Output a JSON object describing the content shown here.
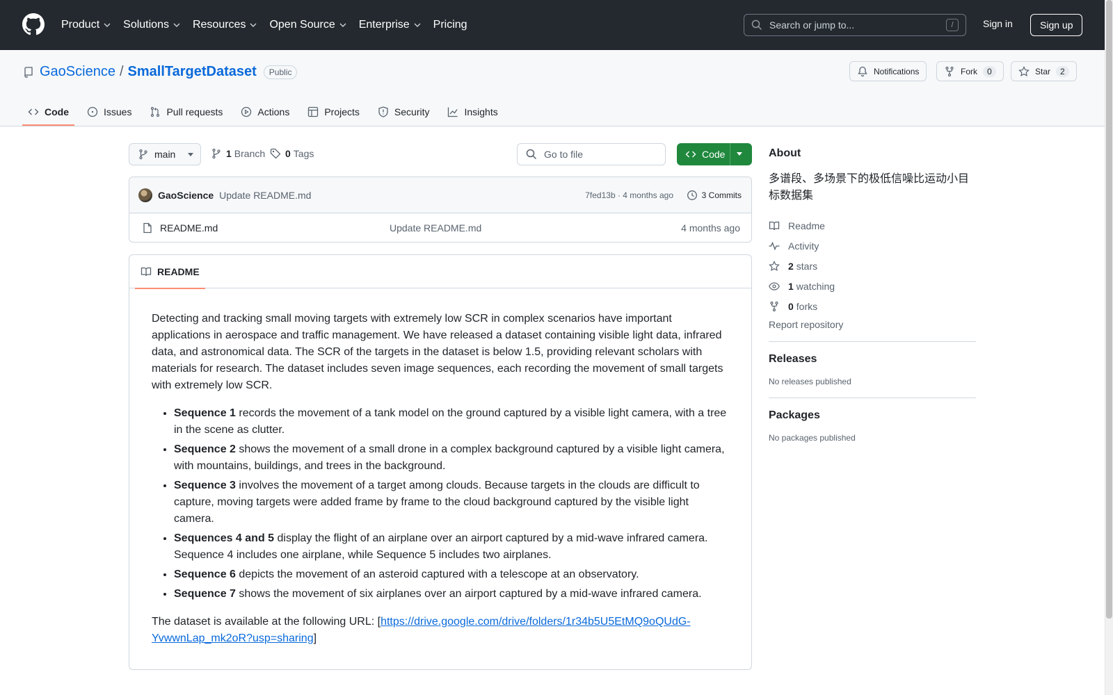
{
  "header": {
    "nav": [
      "Product",
      "Solutions",
      "Resources",
      "Open Source",
      "Enterprise",
      "Pricing"
    ],
    "search_placeholder": "Search or jump to...",
    "search_key": "/",
    "signin": "Sign in",
    "signup": "Sign up"
  },
  "repo": {
    "owner": "GaoScience",
    "separator": "/",
    "name": "SmallTargetDataset",
    "visibility": "Public",
    "notifications": "Notifications",
    "fork_label": "Fork",
    "fork_count": "0",
    "star_label": "Star",
    "star_count": "2"
  },
  "tabs": [
    "Code",
    "Issues",
    "Pull requests",
    "Actions",
    "Projects",
    "Security",
    "Insights"
  ],
  "branch": {
    "name": "main",
    "branch_count": "1",
    "branch_label": "Branch",
    "tag_count": "0",
    "tag_label": "Tags",
    "goto_placeholder": "Go to file",
    "code_button": "Code"
  },
  "commit": {
    "author": "GaoScience",
    "message": "Update README.md",
    "sha_time": "7fed13b · 4 months ago",
    "commits": "3 Commits"
  },
  "files": [
    {
      "name": "README.md",
      "message": "Update README.md",
      "date": "4 months ago"
    }
  ],
  "readme": {
    "tab": "README",
    "intro": "Detecting and tracking small moving targets with extremely low SCR in complex scenarios have important applications in aerospace and traffic management. We have released a dataset containing visible light data, infrared data, and astronomical data. The SCR of the targets in the dataset is below 1.5, providing relevant scholars with materials for research. The dataset includes seven image sequences, each recording the movement of small targets with extremely low SCR.",
    "items": [
      {
        "bold": "Sequence 1",
        "text": " records the movement of a tank model on the ground captured by a visible light camera, with a tree in the scene as clutter."
      },
      {
        "bold": "Sequence 2",
        "text": " shows the movement of a small drone in a complex background captured by a visible light camera, with mountains, buildings, and trees in the background."
      },
      {
        "bold": "Sequence 3",
        "text": " involves the movement of a target among clouds. Because targets in the clouds are difficult to capture, moving targets were added frame by frame to the cloud background captured by the visible light camera."
      },
      {
        "bold": "Sequences 4 and 5",
        "text": " display the flight of an airplane over an airport captured by a mid-wave infrared camera. Sequence 4 includes one airplane, while Sequence 5 includes two airplanes."
      },
      {
        "bold": "Sequence 6",
        "text": " depicts the movement of an asteroid captured with a telescope at an observatory."
      },
      {
        "bold": "Sequence 7",
        "text": " shows the movement of six airplanes over an airport captured by a mid-wave infrared camera."
      }
    ],
    "url_prefix": "The dataset is available at the following URL: [",
    "url": "https://drive.google.com/drive/folders/1r34b5U5EtMQ9oQUdG-YvwwnLap_mk2oR?usp=sharing",
    "url_suffix": "]"
  },
  "about": {
    "title": "About",
    "description": "多谱段、多场景下的极低信噪比运动小目标数据集",
    "readme": "Readme",
    "activity": "Activity",
    "stars_count": "2",
    "stars_label": "stars",
    "watching_count": "1",
    "watching_label": "watching",
    "forks_count": "0",
    "forks_label": "forks",
    "report": "Report repository"
  },
  "releases": {
    "title": "Releases",
    "empty": "No releases published"
  },
  "packages": {
    "title": "Packages",
    "empty": "No packages published"
  }
}
